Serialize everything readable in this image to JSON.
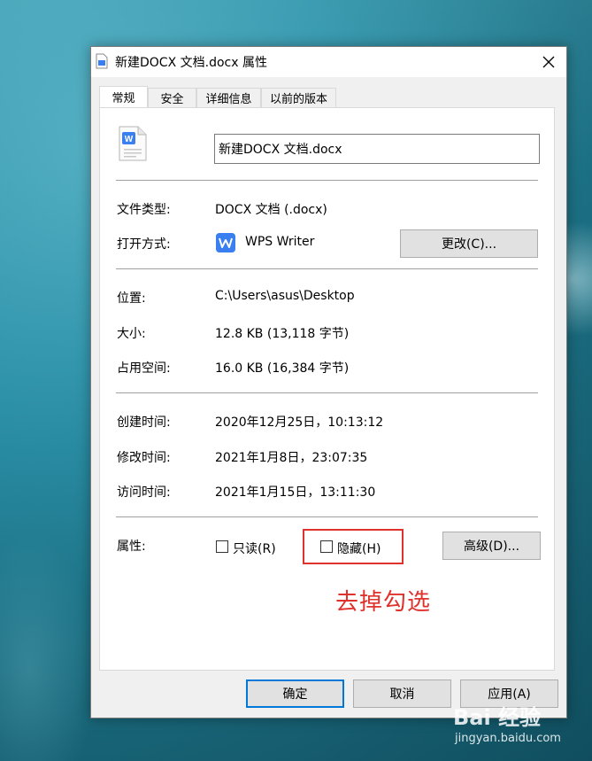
{
  "window": {
    "title": "新建DOCX 文档.docx 属性"
  },
  "tabs": [
    "常规",
    "安全",
    "详细信息",
    "以前的版本"
  ],
  "general": {
    "filename": "新建DOCX 文档.docx",
    "type_label": "文件类型:",
    "type_value": "DOCX 文档 (.docx)",
    "opens_label": "打开方式:",
    "opens_value": "WPS Writer",
    "change_button": "更改(C)...",
    "location_label": "位置:",
    "location_value": "C:\\Users\\asus\\Desktop",
    "size_label": "大小:",
    "size_value": "12.8 KB (13,118 字节)",
    "disk_label": "占用空间:",
    "disk_value": "16.0 KB (16,384 字节)",
    "created_label": "创建时间:",
    "created_value": "2020年12月25日，10:13:12",
    "modified_label": "修改时间:",
    "modified_value": "2021年1月8日，23:07:35",
    "accessed_label": "访问时间:",
    "accessed_value": "2021年1月15日，13:11:30",
    "attributes_label": "属性:",
    "readonly_label": "只读(R)",
    "readonly_checked": false,
    "hidden_label": "隐藏(H)",
    "hidden_checked": false,
    "advanced_button": "高级(D)..."
  },
  "footer": {
    "ok": "确定",
    "cancel": "取消",
    "apply": "应用(A)"
  },
  "annotation": "去掉勾选",
  "watermark": {
    "main": "Bai 经验",
    "sub": "jingyan.baidu.com"
  },
  "colors": {
    "accent": "#0078d7",
    "annotation": "#e0322c",
    "wps": "#3a7ff0"
  },
  "icons": {
    "title": "docx-file-icon",
    "file": "wps-document-icon",
    "app": "wps-writer-icon",
    "close": "close-icon"
  }
}
